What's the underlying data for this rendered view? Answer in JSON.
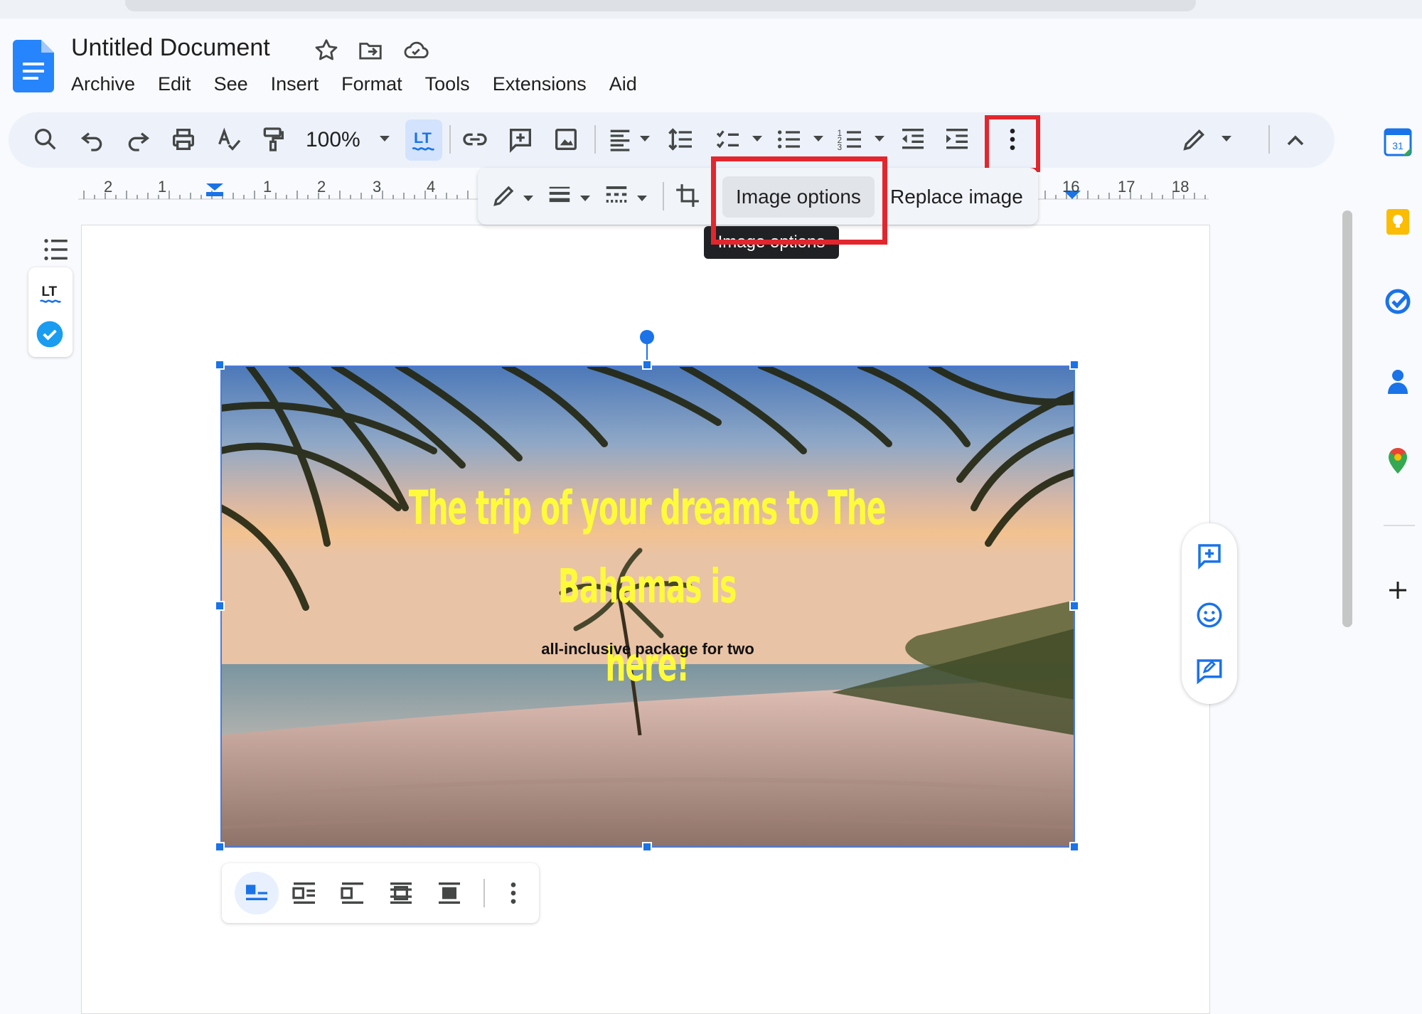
{
  "document": {
    "title": "Untitled Document"
  },
  "menu": [
    "Archive",
    "Edit",
    "See",
    "Insert",
    "Format",
    "Tools",
    "Extensions",
    "Aid"
  ],
  "toolbar": {
    "zoom": "100%"
  },
  "ruler": {
    "labels": [
      "2",
      "1",
      "1",
      "2",
      "3",
      "4",
      "16",
      "17",
      "18"
    ]
  },
  "image_toolbar": {
    "image_options_label": "Image options",
    "replace_image_label": "Replace image",
    "tooltip": "Image options"
  },
  "image": {
    "title_line1": "The trip of your dreams to The Bahamas is",
    "title_line2": "here!",
    "subtitle": "all-inclusive package for two"
  },
  "rail": {
    "calendar_day": "31"
  },
  "colors": {
    "accent": "#1a73e8",
    "highlight": "#e3262d",
    "toolbar_bg": "#edf2fa",
    "hero_title": "#fffb3a"
  }
}
